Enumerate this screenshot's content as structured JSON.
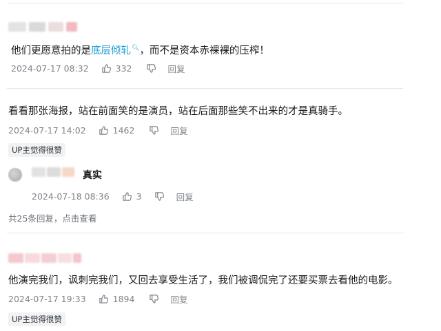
{
  "comments": [
    {
      "text_before": "他们更愿意拍的是",
      "highlight": "底层倾轧",
      "text_after": "，而不是资本赤裸裸的压榨！",
      "time": "2024-07-17 08:32",
      "likes": "332",
      "reply_label": "回复"
    },
    {
      "text": "看看那张海报，站在前面笑的是演员，站在后面那些笑不出来的才是真骑手。",
      "time": "2024-07-17 14:02",
      "likes": "1462",
      "reply_label": "回复",
      "tag": "UP主觉得很赞",
      "sub_reply": {
        "text": "真实",
        "time": "2024-07-18 08:36",
        "likes": "3",
        "reply_label": "回复"
      },
      "more_replies": "共25条回复，点击查看"
    },
    {
      "text": "他演完我们，讽刺完我们，又回去享受生活了，我们被调侃完了还要买票去看他的电影。",
      "time": "2024-07-17 19:33",
      "likes": "1894",
      "reply_label": "回复",
      "tag": "UP主觉得很赞"
    }
  ],
  "colors": {
    "highlight": "#1f9fd3",
    "meta": "#7f848b",
    "tag_bg": "#f1f2f3"
  },
  "icons": [
    "search-icon",
    "thumb-up-icon",
    "thumb-down-icon"
  ]
}
